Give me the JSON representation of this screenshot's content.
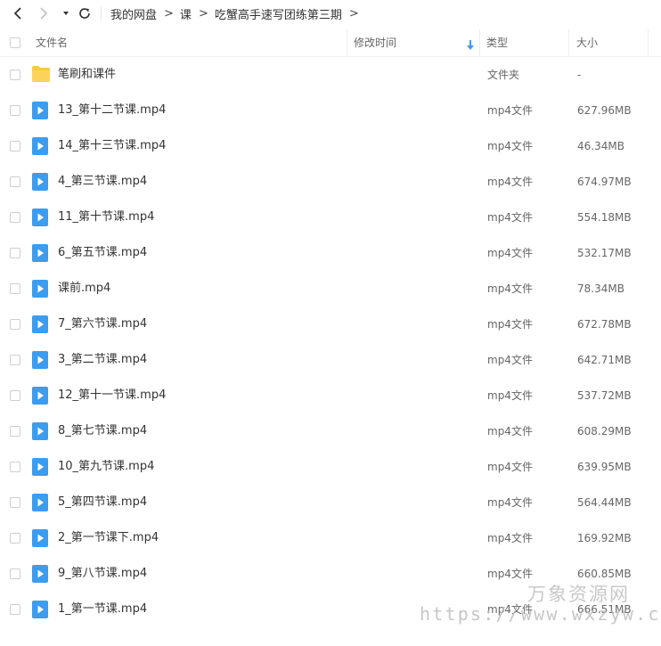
{
  "breadcrumb": [
    "我的网盘",
    "课",
    "吃蟹高手速写团练第三期"
  ],
  "columns": {
    "name": "文件名",
    "modified": "修改时间",
    "type": "类型",
    "size": "大小"
  },
  "icons": {
    "back": "back-arrow-icon",
    "forward": "forward-arrow-icon",
    "history": "dropdown-caret-icon",
    "refresh": "refresh-icon",
    "sort": "sort-down-icon",
    "folder": "folder-icon",
    "video": "video-file-icon"
  },
  "colors": {
    "folder": "#f7c84a",
    "video": "#3b9cf0",
    "sort_arrow": "#3b9cf0"
  },
  "files": [
    {
      "name": "笔刷和课件",
      "type": "文件夹",
      "size": "-",
      "kind": "folder"
    },
    {
      "name": "13_第十二节课.mp4",
      "type": "mp4文件",
      "size": "627.96MB",
      "kind": "video"
    },
    {
      "name": "14_第十三节课.mp4",
      "type": "mp4文件",
      "size": "46.34MB",
      "kind": "video"
    },
    {
      "name": "4_第三节课.mp4",
      "type": "mp4文件",
      "size": "674.97MB",
      "kind": "video"
    },
    {
      "name": "11_第十节课.mp4",
      "type": "mp4文件",
      "size": "554.18MB",
      "kind": "video"
    },
    {
      "name": "6_第五节课.mp4",
      "type": "mp4文件",
      "size": "532.17MB",
      "kind": "video"
    },
    {
      "name": "课前.mp4",
      "type": "mp4文件",
      "size": "78.34MB",
      "kind": "video"
    },
    {
      "name": "7_第六节课.mp4",
      "type": "mp4文件",
      "size": "672.78MB",
      "kind": "video"
    },
    {
      "name": "3_第二节课.mp4",
      "type": "mp4文件",
      "size": "642.71MB",
      "kind": "video"
    },
    {
      "name": "12_第十一节课.mp4",
      "type": "mp4文件",
      "size": "537.72MB",
      "kind": "video"
    },
    {
      "name": "8_第七节课.mp4",
      "type": "mp4文件",
      "size": "608.29MB",
      "kind": "video"
    },
    {
      "name": "10_第九节课.mp4",
      "type": "mp4文件",
      "size": "639.95MB",
      "kind": "video"
    },
    {
      "name": "5_第四节课.mp4",
      "type": "mp4文件",
      "size": "564.44MB",
      "kind": "video"
    },
    {
      "name": "2_第一节课下.mp4",
      "type": "mp4文件",
      "size": "169.92MB",
      "kind": "video"
    },
    {
      "name": "9_第八节课.mp4",
      "type": "mp4文件",
      "size": "660.85MB",
      "kind": "video"
    },
    {
      "name": "1_第一节课.mp4",
      "type": "mp4文件",
      "size": "666.51MB",
      "kind": "video"
    }
  ],
  "watermark": {
    "title": "万象资源网",
    "url": "https://www.wxzyw.cn"
  }
}
